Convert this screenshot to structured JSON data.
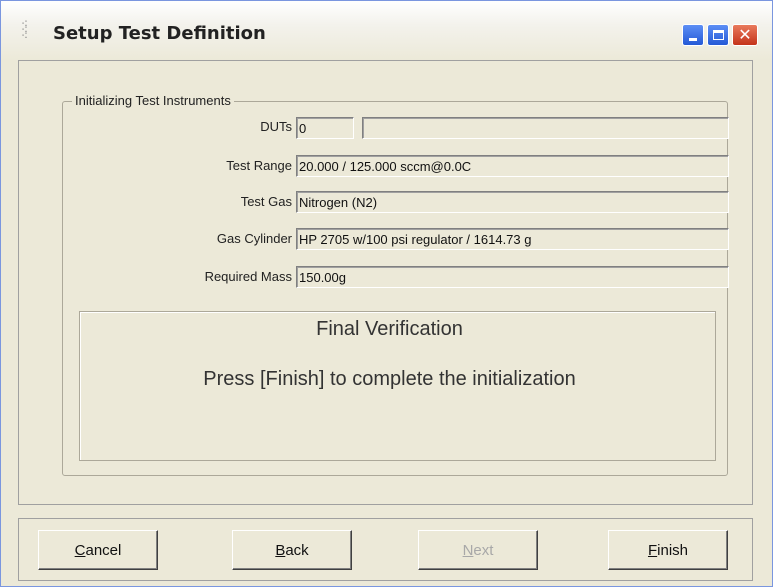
{
  "window": {
    "title": "Setup Test Definition",
    "icon": "app-icon",
    "controls": [
      "minimize-icon",
      "maximize-icon",
      "close-icon"
    ]
  },
  "group": {
    "legend": "Initializing Test Instruments",
    "fields": [
      {
        "label": "DUTs",
        "value": "0",
        "extra": ""
      },
      {
        "label": "Test Range",
        "value": "20.000 / 125.000 sccm@0.0C"
      },
      {
        "label": "Test Gas",
        "value": "Nitrogen (N2)"
      },
      {
        "label": "Gas Cylinder",
        "value": "HP 2705 w/100 psi regulator / 1614.73 g"
      },
      {
        "label": "Required Mass",
        "value": "150.00g"
      }
    ]
  },
  "verification": {
    "title": "Final Verification",
    "message": "Press [Finish] to complete the initialization"
  },
  "buttons": {
    "cancel": {
      "first": "C",
      "rest": "ancel",
      "enabled": true
    },
    "back": {
      "first": "B",
      "rest": "ack",
      "enabled": true
    },
    "next": {
      "first": "N",
      "rest": "ext",
      "enabled": false
    },
    "finish": {
      "first": "F",
      "rest": "inish",
      "enabled": true
    }
  },
  "colors": {
    "dialog_bg": "#ece9d8",
    "title_btn_blue": "#2459d6",
    "close_btn_red": "#c4331a"
  }
}
